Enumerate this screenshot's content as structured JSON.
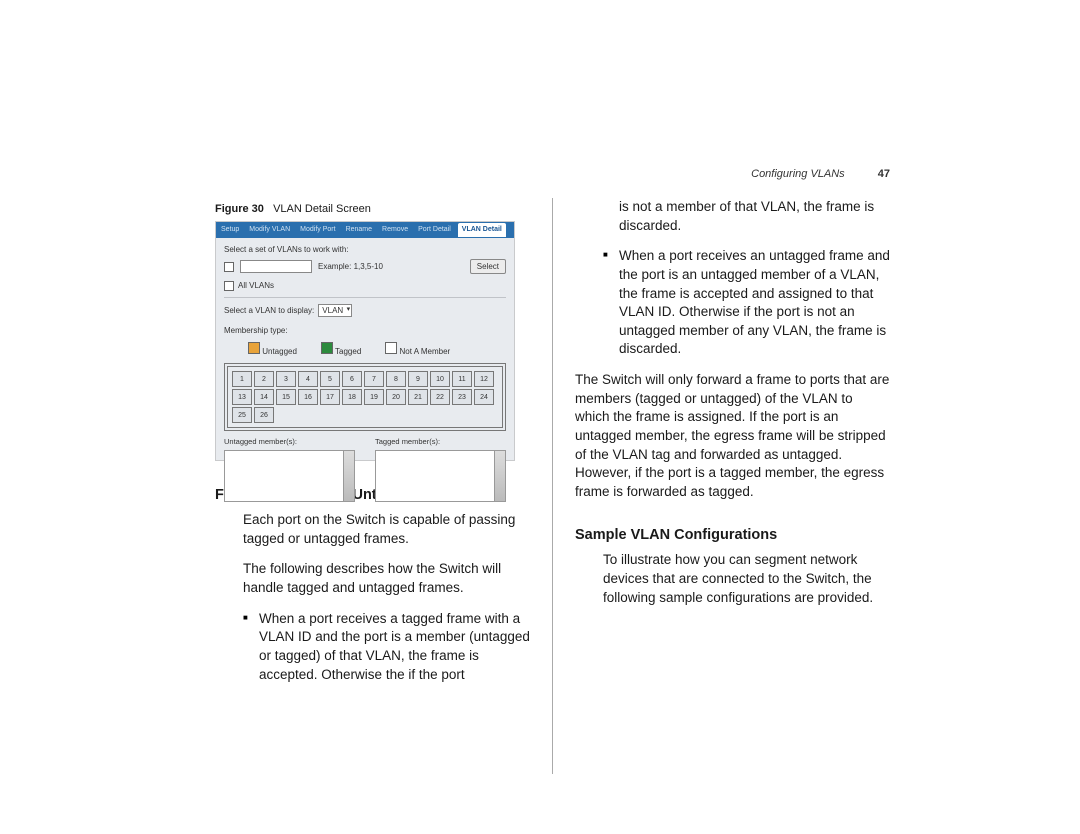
{
  "header": {
    "section": "Configuring VLANs",
    "page": "47"
  },
  "figure": {
    "caption_prefix": "Figure 30",
    "caption_text": "VLAN Detail Screen",
    "tabs": [
      "Setup",
      "Modify VLAN",
      "Modify Port",
      "Rename",
      "Remove",
      "Port Detail"
    ],
    "active_tab": "VLAN Detail",
    "line1": "Select a set of VLANs to work with:",
    "example": "Example: 1,3,5-10",
    "all_label": "All VLANs",
    "select_btn": "Select",
    "display_label": "Select a VLAN to display:",
    "dropdown": "VLAN",
    "membership_label": "Membership type:",
    "legend": {
      "untagged": "Untagged",
      "tagged": "Tagged",
      "nonmember": "Not A Member"
    },
    "untagged_box": "Untagged member(s):",
    "tagged_box": "Tagged member(s):"
  },
  "left": {
    "heading": "Forwarding Tagged/Untagged Frames",
    "p1": "Each port on the Switch is capable of passing tagged or untagged frames.",
    "p2": "The following describes how the Switch will handle tagged and untagged frames.",
    "b1": "When a port receives a tagged frame with a VLAN ID and the port is a member (untagged or tagged) of that VLAN, the frame is accepted. Otherwise the if the port"
  },
  "right": {
    "cont": "is not a member of that VLAN, the frame is discarded.",
    "b2": "When a port receives an untagged frame and the port is an untagged member of a VLAN, the frame is accepted and assigned to that VLAN ID. Otherwise if the port is not an untagged member of any VLAN, the frame is discarded.",
    "p3": "The Switch will only forward a frame to ports that are members (tagged or untagged) of the VLAN to which the frame is assigned. If the port is an untagged member, the egress frame will be stripped of the VLAN tag and forwarded as untagged. However, if the port is a tagged member, the egress frame is forwarded as tagged.",
    "heading2": "Sample VLAN Configurations",
    "p4": "To illustrate how you can segment network devices that are connected to the Switch, the following sample configurations are provided."
  }
}
